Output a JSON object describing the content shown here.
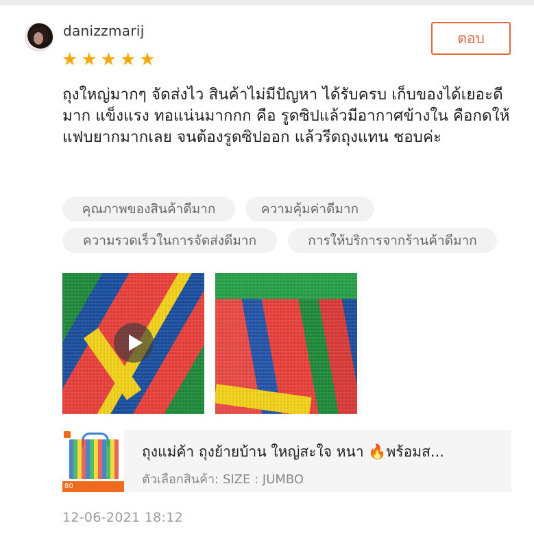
{
  "review": {
    "username": "danizzmarij",
    "rating": 5,
    "star_glyph": "★",
    "reply_label": "ตอบ",
    "text": "ถุงใหญ่มากๆ จัดส่งไว สินค้าไม่มีปัญหา ได้รับครบ เก็บของได้เยอะดีมาก แข็งแรง ทอแน่นมากกก คือ รูดซิปแล้วมีอากาศข้างใน คือกดให้แฟบยากมากเลย จนต้องรูดซิปออก แล้วรีดถุงแทน ชอบค่ะ",
    "tags": [
      "คุณภาพของสินค้าดีมาก",
      "ความคุ้มค่าดีมาก",
      "ความรวดเร็วในการจัดส่งดีมาก",
      "การให้บริการจากร้านค้าดีมาก"
    ],
    "media": [
      {
        "type": "video"
      },
      {
        "type": "image"
      }
    ],
    "product": {
      "title": "ถุงแม่ค้า ถุงย้ายบ้าน ใหญ่สะใจ หนา 🔥พร้อมส...",
      "variant_label": "ตัวเลือกสินค้า:",
      "variant_value": "SIZE : JUMBO",
      "thumb_price": "80"
    },
    "date": "12-06-2021 18:12"
  },
  "colors": {
    "accent": "#e5673f",
    "star": "#f6a700",
    "tag_bg": "#f2f2f2",
    "product_bg": "#f5f5f5"
  }
}
